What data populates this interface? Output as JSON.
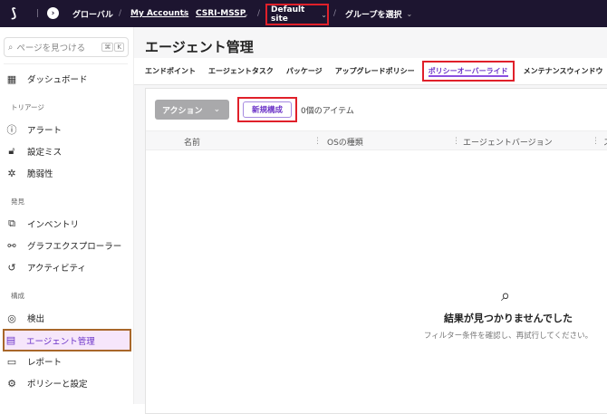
{
  "topbar": {
    "global": "グローバル",
    "accounts": "My Accounts",
    "account": "CSRI-MSSP",
    "site": "Default site",
    "group": "グループを選択"
  },
  "sidebar": {
    "search_placeholder": "ページを見つける",
    "shortcut_cmd": "⌘",
    "shortcut_key": "K",
    "dashboard": "ダッシュボード",
    "sections": [
      {
        "label": "トリアージ",
        "items": [
          "アラート",
          "設定ミス",
          "脆弱性"
        ]
      },
      {
        "label": "発見",
        "items": [
          "インベントリ",
          "グラフエクスプローラー",
          "アクティビティ"
        ]
      },
      {
        "label": "構成",
        "items": [
          "検出",
          "エージェント管理",
          "レポート",
          "ポリシーと設定"
        ]
      }
    ]
  },
  "main": {
    "title": "エージェント管理",
    "tabs": [
      "エンドポイント",
      "エージェントタスク",
      "パッケージ",
      "アップグレードポリシー",
      "ポリシーオーバーライド",
      "メンテナンスウィンドウ"
    ],
    "action_label": "アクション",
    "new_label": "新規構成",
    "count": "0個のアイテム",
    "columns": [
      "名前",
      "OSの種類",
      "エージェントバージョン",
      "ス"
    ],
    "empty_title": "結果が見つかりませんでした",
    "empty_sub": "フィルター条件を確認し、再試行してください。"
  }
}
